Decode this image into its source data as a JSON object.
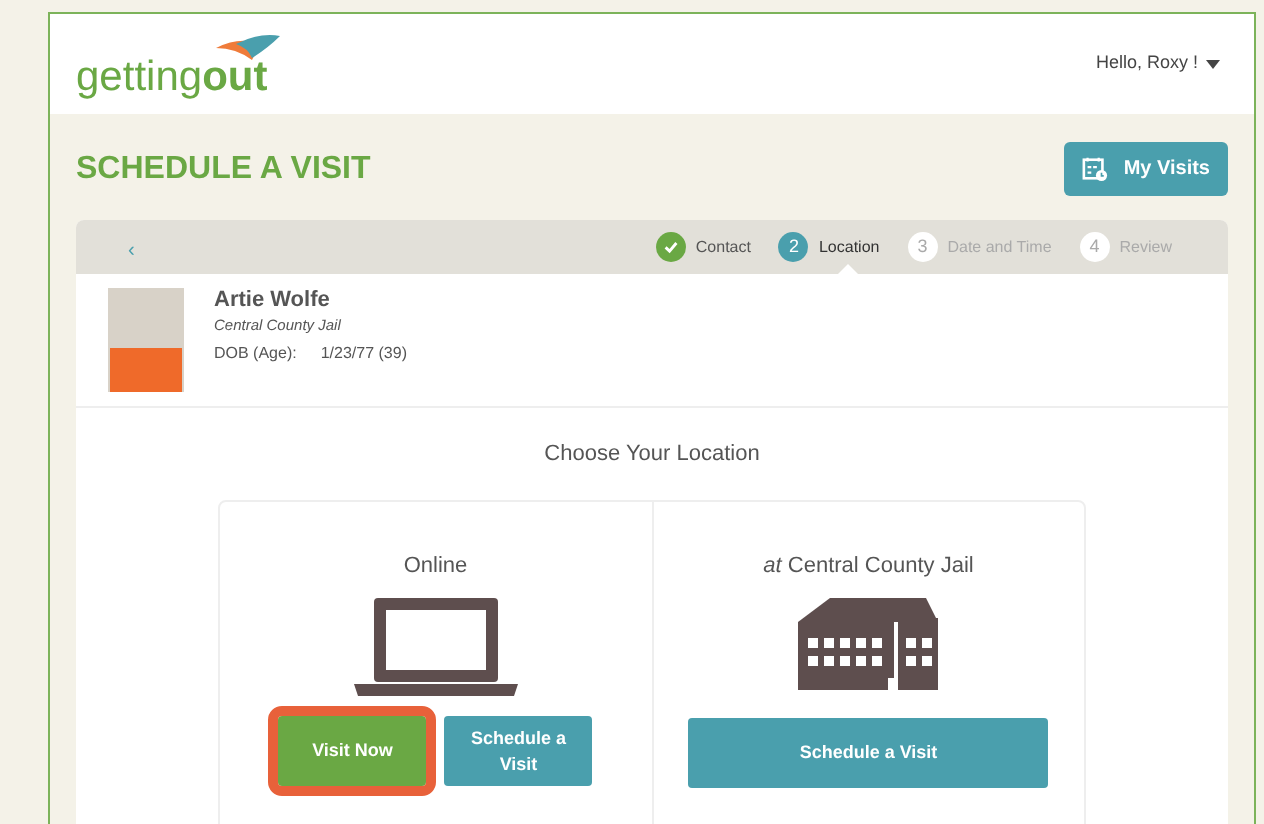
{
  "logo": {
    "text_light": "getting",
    "text_bold": "out"
  },
  "user_menu": {
    "label": "Hello, Roxy !"
  },
  "page_title": "SCHEDULE A VISIT",
  "my_visits_button": {
    "label": "My Visits"
  },
  "back_button": {
    "label": "‹"
  },
  "steps": [
    {
      "label": "Contact",
      "completed": true,
      "selected": false
    },
    {
      "number": "2",
      "label": "Location",
      "completed": false,
      "selected": true
    },
    {
      "number": "3",
      "label": "Date and Time",
      "completed": false,
      "selected": false
    },
    {
      "number": "4",
      "label": "Review",
      "completed": false,
      "selected": false
    }
  ],
  "inmate": {
    "name": "Artie Wolfe",
    "facility": "Central County Jail",
    "dob_label": "DOB (Age):",
    "dob_value": "1/23/77 (39)"
  },
  "section_title": "Choose Your Location",
  "options": [
    {
      "kind": "online",
      "title": "Online",
      "buttons": [
        {
          "label": "Visit Now",
          "kind": "primary",
          "highlighted": true
        },
        {
          "label": "Schedule a Visit",
          "kind": "secondary",
          "highlighted": false
        }
      ]
    },
    {
      "kind": "facility",
      "title": "*at* Central County Jail",
      "buttons": [
        {
          "label": "Schedule a Visit",
          "kind": "secondary",
          "highlighted": false
        }
      ]
    }
  ]
}
